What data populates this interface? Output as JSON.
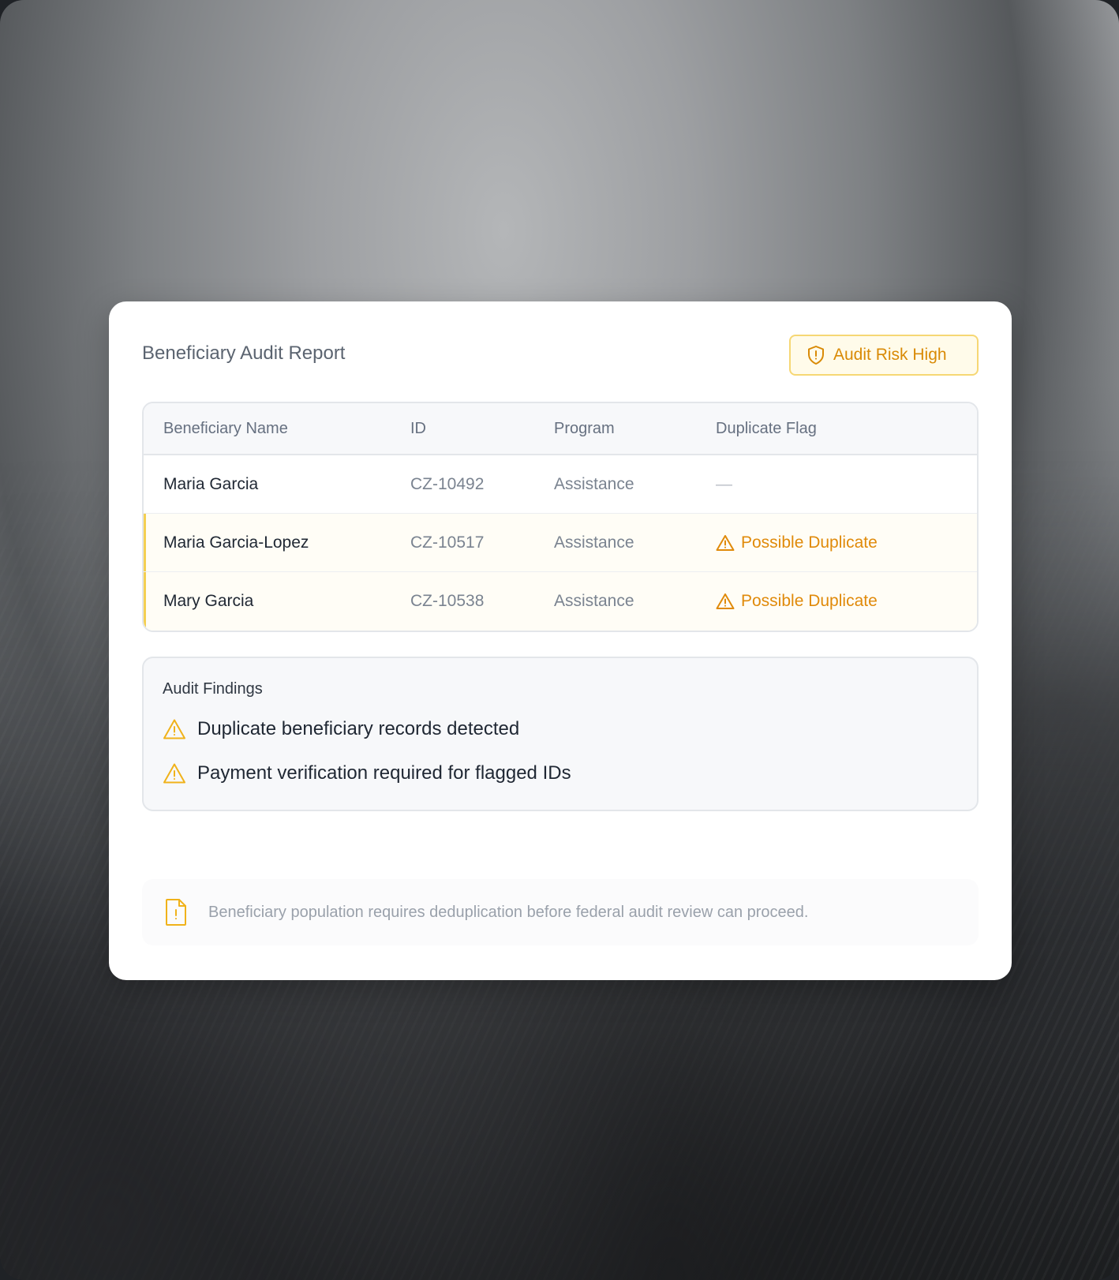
{
  "report": {
    "title": "Beneficiary Audit Report",
    "risk_badge": {
      "label": "Audit Risk High",
      "icon": "shield-alert-icon",
      "color": "#d98a06"
    }
  },
  "table": {
    "columns": [
      "Beneficiary Name",
      "ID",
      "Program",
      "Duplicate Flag"
    ],
    "rows": [
      {
        "name": "Maria Garcia",
        "id": "CZ-10492",
        "program": "Assistance",
        "flag": "—",
        "flagged": false
      },
      {
        "name": "Maria Garcia-Lopez",
        "id": "CZ-10517",
        "program": "Assistance",
        "flag": "Possible Duplicate",
        "flagged": true
      },
      {
        "name": "Mary Garcia",
        "id": "CZ-10538",
        "program": "Assistance",
        "flag": "Possible Duplicate",
        "flagged": true
      }
    ]
  },
  "findings": {
    "title": "Audit Findings",
    "items": [
      "Duplicate beneficiary records detected",
      "Payment verification required for flagged IDs"
    ]
  },
  "note": {
    "icon": "file-alert-icon",
    "text": "Beneficiary population requires deduplication before federal audit review can proceed."
  },
  "colors": {
    "warning": "#e08a0a",
    "badge_border": "#f6d774",
    "flag_bar": "#f4cf52"
  }
}
